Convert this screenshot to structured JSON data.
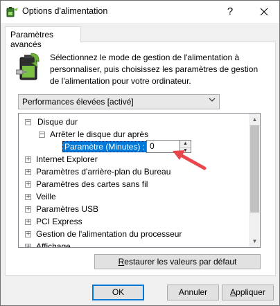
{
  "window": {
    "title": "Options d'alimentation",
    "help_label": "?",
    "close_label": "✕"
  },
  "tab": {
    "label": "Paramètres avancés"
  },
  "description": "Sélectionnez le mode de gestion de l'alimentation à personnaliser, puis choisissez les paramètres de gestion de l'alimentation pour votre ordinateur.",
  "plan_select": {
    "value": "Performances élevées [activé]"
  },
  "tree": {
    "items": [
      {
        "label": "Disque dur",
        "expander": "−"
      },
      {
        "label": "Arrêter le disque dur après",
        "expander": "−"
      },
      {
        "label": "Internet Explorer",
        "expander": "+"
      },
      {
        "label": "Paramètres d'arrière-plan du Bureau",
        "expander": "+"
      },
      {
        "label": "Paramètres des cartes sans fil",
        "expander": "+"
      },
      {
        "label": "Veille",
        "expander": "+"
      },
      {
        "label": "Paramètres USB",
        "expander": "+"
      },
      {
        "label": "PCI Express",
        "expander": "+"
      },
      {
        "label": "Gestion de l'alimentation du processeur",
        "expander": "+"
      },
      {
        "label": "Affichage",
        "expander": "+"
      }
    ],
    "setting": {
      "label": "Paramètre (Minutes) :",
      "value": "0"
    }
  },
  "buttons": {
    "restore_prefix": "R",
    "restore_rest": "estaurer les valeurs par défaut",
    "ok": "OK",
    "cancel": "Annuler",
    "apply_prefix": "A",
    "apply_rest": "ppliquer"
  },
  "colors": {
    "selection": "#0078d7",
    "arrow": "#e8474c"
  }
}
